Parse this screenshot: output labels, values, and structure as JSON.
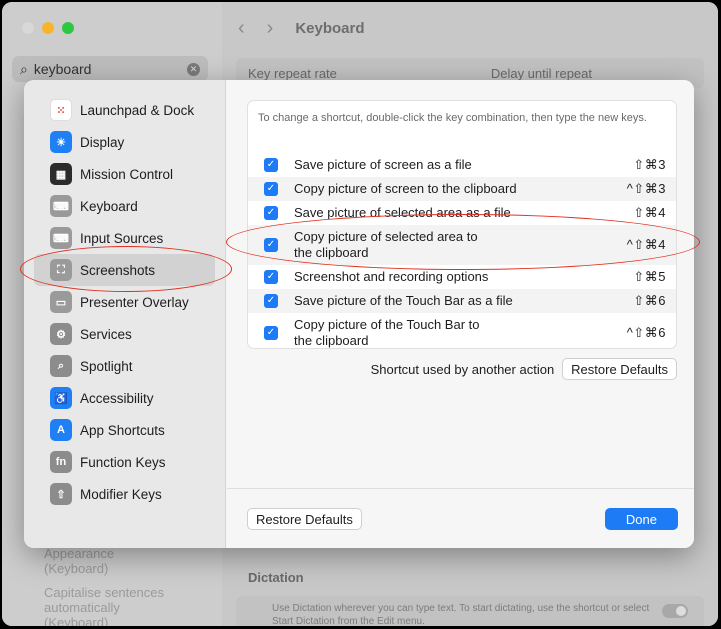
{
  "background": {
    "search": {
      "value": "keyboard"
    },
    "toolbar": {
      "back": "‹",
      "forward": "›",
      "title": "Keyboard"
    },
    "key_repeat_label": "Key repeat rate",
    "delay_label": "Delay until repeat",
    "ghost_side": [
      "Appearance",
      "(Keyboard)",
      "Capitalise sentences",
      "automatically",
      "(Keyboard)"
    ],
    "dictation_title": "Dictation",
    "dictation_text": "Use Dictation wherever you can type text. To start dictating, use the shortcut or select Start Dictation from the Edit menu."
  },
  "sidebar": {
    "items": [
      {
        "label": "Launchpad & Dock",
        "icon": "launchpad-icon",
        "color": "#ffffff",
        "glyph": "⁙"
      },
      {
        "label": "Display",
        "icon": "display-icon",
        "color": "#1f7ff5",
        "glyph": "☀"
      },
      {
        "label": "Mission Control",
        "icon": "mission-control-icon",
        "color": "#2b2b2b",
        "glyph": "▦"
      },
      {
        "label": "Keyboard",
        "icon": "keyboard-icon",
        "color": "#9a9a9a",
        "glyph": "⌨"
      },
      {
        "label": "Input Sources",
        "icon": "input-sources-icon",
        "color": "#9a9a9a",
        "glyph": "⌨"
      },
      {
        "label": "Screenshots",
        "icon": "screenshot-icon",
        "color": "#9a9a9a",
        "glyph": "⛶"
      },
      {
        "label": "Presenter Overlay",
        "icon": "presenter-overlay-icon",
        "color": "#9a9a9a",
        "glyph": "▭"
      },
      {
        "label": "Services",
        "icon": "gear-icon",
        "color": "#8c8c8c",
        "glyph": "⚙"
      },
      {
        "label": "Spotlight",
        "icon": "spotlight-icon",
        "color": "#8c8c8c",
        "glyph": "⌕"
      },
      {
        "label": "Accessibility",
        "icon": "accessibility-icon",
        "color": "#1f7ff5",
        "glyph": "♿"
      },
      {
        "label": "App Shortcuts",
        "icon": "app-shortcuts-icon",
        "color": "#1f7ff5",
        "glyph": "A"
      },
      {
        "label": "Function Keys",
        "icon": "function-keys-icon",
        "color": "#8c8c8c",
        "glyph": "fn"
      },
      {
        "label": "Modifier Keys",
        "icon": "modifier-keys-icon",
        "color": "#8c8c8c",
        "glyph": "⇧"
      }
    ],
    "selected": "Screenshots"
  },
  "panel": {
    "hint": "To change a shortcut, double-click the key combination, then type the new keys.",
    "rows": [
      {
        "label": "Save picture of screen as a file",
        "key": "⇧⌘3",
        "checked": true
      },
      {
        "label": "Copy picture of screen to the clipboard",
        "key": "^⇧⌘3",
        "checked": true
      },
      {
        "label": "Save picture of selected area as a file",
        "key": "⇧⌘4",
        "checked": true
      },
      {
        "label": "Copy picture of selected area to the clipboard",
        "key": "^⇧⌘4",
        "checked": true
      },
      {
        "label": "Screenshot and recording options",
        "key": "⇧⌘5",
        "checked": true
      },
      {
        "label": "Save picture of the Touch Bar as a file",
        "key": "⇧⌘6",
        "checked": true
      },
      {
        "label": "Copy picture of the Touch Bar to the clipboard",
        "key": "^⇧⌘6",
        "checked": true
      }
    ]
  },
  "conflict_text": "Shortcut used by another action",
  "restore_defaults_panel": "Restore Defaults",
  "footer": {
    "restore": "Restore Defaults",
    "done": "Done"
  },
  "colors": {
    "accent": "#1d7bf5",
    "annotation": "#e0301e"
  }
}
